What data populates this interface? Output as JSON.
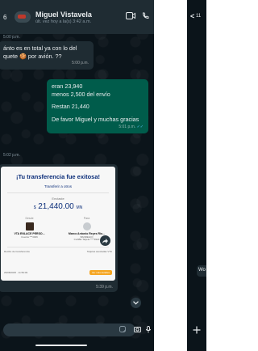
{
  "left_chat": {
    "header": {
      "time_partial": "6",
      "contact_name": "Miguel Vistavela",
      "status": "últ. vez hoy a la(s) 3:42 a.m.",
      "video_icon": "video-call-icon",
      "phone_icon": "phone-call-icon"
    },
    "messages": [
      {
        "id": "m1",
        "direction": "incoming",
        "top_time": "5:00 p.m.",
        "text_line1": "ánto es en total ya con lo del",
        "text_line2": "quete 🍪 por avión. ??",
        "time": "5:00 p.m."
      },
      {
        "id": "m2",
        "direction": "outgoing",
        "lines": [
          "eran 23,940",
          "menos 2,500 del envío",
          "Restan 21,440",
          "De favor Miguel y muchas gracias"
        ],
        "time": "5:01 p.m."
      }
    ],
    "receipt_time_label": "5:02 p.m.",
    "receipt": {
      "title": "¡Tu transferencia fue exitosa!",
      "subtitle": "Transferir a otros",
      "sent_label": "Enviaste",
      "amount_prefix": "$",
      "amount_value": "21,440.00",
      "amount_currency": "MN",
      "from_label": "Desde",
      "from_name": "VTA ENLACE PERSO...",
      "from_detail": "Cuenta ***4026",
      "to_label": "Para",
      "to_name": "Marco Antonio Reyes Rio...",
      "to_subname": "BANREGIO",
      "to_detail": "CLABE Tarjeta ****9324",
      "footer_left": "Recibo de transferencia",
      "footer_right": "Tarjetas asociadas VTA",
      "footer_date": "29/08/2025 · 11:59:09",
      "footer_button": "Ver más detalles",
      "time": "5:39 p.m."
    },
    "forward_icon": "forward-icon",
    "scroll_down_icon": "chevron-down-icon",
    "input": {
      "placeholder": "",
      "sticker_icon": "sticker-icon",
      "camera_icon": "camera-icon",
      "mic_icon": "mic-icon"
    }
  },
  "right_chat": {
    "header": {
      "back_label": "<",
      "unread_count": "11"
    },
    "message_partial": "Wo",
    "plus_icon": "plus-icon"
  },
  "colors": {
    "chat_bg": "#0b141a",
    "header_bg": "#1f2c33",
    "incoming_bubble": "#1f2c33",
    "outgoing_bubble": "#005c4b",
    "receipt_title": "#0b2e7a",
    "receipt_button": "#f5a623"
  }
}
